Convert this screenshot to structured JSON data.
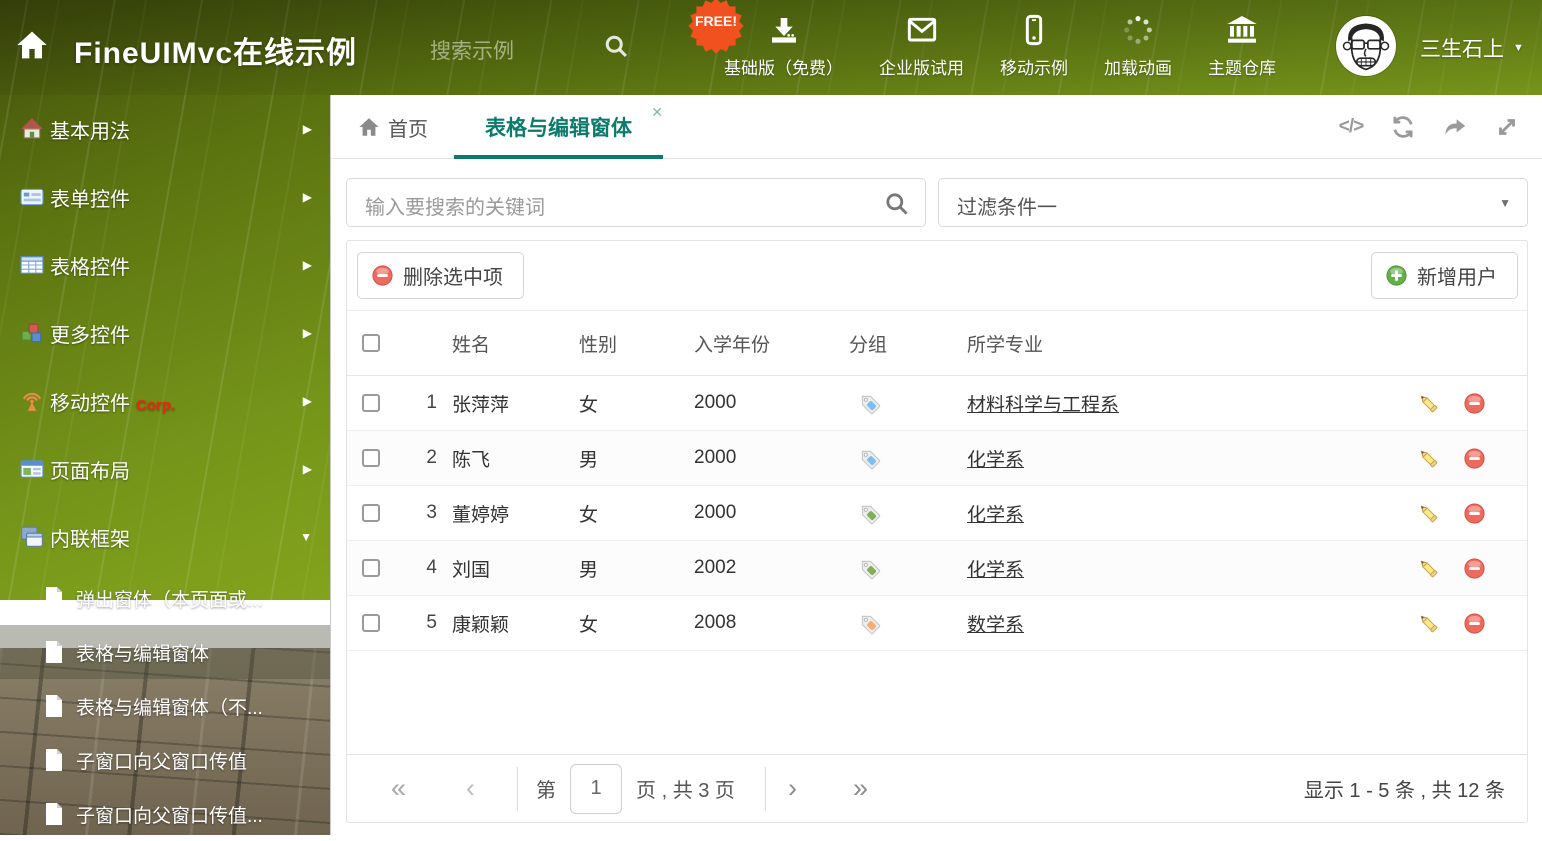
{
  "header": {
    "title": "FineUIMvc在线示例",
    "search_placeholder": "搜索示例",
    "free_badge": "FREE!",
    "nav": [
      {
        "label": "基础版（免费）",
        "icon": "download-icon"
      },
      {
        "label": "企业版试用",
        "icon": "envelope-icon"
      },
      {
        "label": "移动示例",
        "icon": "phone-icon"
      },
      {
        "label": "加载动画",
        "icon": "spinner-icon"
      },
      {
        "label": "主题仓库",
        "icon": "bank-icon"
      }
    ],
    "user_name": "三生石上"
  },
  "sidebar": {
    "items": [
      {
        "label": "基本用法",
        "icon": "home-icon"
      },
      {
        "label": "表单控件",
        "icon": "form-icon"
      },
      {
        "label": "表格控件",
        "icon": "table-icon"
      },
      {
        "label": "更多控件",
        "icon": "cubes-icon"
      },
      {
        "label": "移动控件",
        "badge": "Corp.",
        "icon": "antenna-icon"
      },
      {
        "label": "页面布局",
        "icon": "layout-icon"
      },
      {
        "label": "内联框架",
        "icon": "frames-icon"
      }
    ],
    "subitems": [
      {
        "label": "弹出窗体（本页面或..."
      },
      {
        "label": "表格与编辑窗体",
        "selected": true
      },
      {
        "label": "表格与编辑窗体（不..."
      },
      {
        "label": "子窗口向父窗口传值"
      },
      {
        "label": "子窗口向父窗口传值..."
      }
    ]
  },
  "tabs": {
    "home_label": "首页",
    "active_label": "表格与编辑窗体",
    "close_glyph": "✕"
  },
  "filter": {
    "search_placeholder": "输入要搜索的关键词",
    "dropdown_value": "过滤条件一"
  },
  "toolbar": {
    "delete_label": "删除选中项",
    "add_label": "新增用户"
  },
  "table": {
    "columns": {
      "name": "姓名",
      "gender": "性别",
      "year": "入学年份",
      "group": "分组",
      "major": "所学专业"
    },
    "rows": [
      {
        "num": "1",
        "name": "张萍萍",
        "gender": "女",
        "year": "2000",
        "tag_color": "blue",
        "major": "材料科学与工程系"
      },
      {
        "num": "2",
        "name": "陈飞",
        "gender": "男",
        "year": "2000",
        "tag_color": "blue",
        "major": "化学系"
      },
      {
        "num": "3",
        "name": "董婷婷",
        "gender": "女",
        "year": "2000",
        "tag_color": "green",
        "major": "化学系"
      },
      {
        "num": "4",
        "name": "刘国",
        "gender": "男",
        "year": "2002",
        "tag_color": "green",
        "major": "化学系"
      },
      {
        "num": "5",
        "name": "康颖颖",
        "gender": "女",
        "year": "2008",
        "tag_color": "orange",
        "major": "数学系"
      }
    ]
  },
  "pagination": {
    "first_glyph": "«",
    "prev_glyph": "‹",
    "page_prefix": "第",
    "page_value": "1",
    "page_suffix": "页 , 共 3 页",
    "next_glyph": "›",
    "last_glyph": "»",
    "summary": "显示 1 - 5 条 , 共 12 条"
  },
  "colors": {
    "accent": "#0c7a6d",
    "tag_blue": "#7cbdf2",
    "tag_green": "#82ae55",
    "tag_orange": "#f6ad70",
    "danger": "#ee6a5f",
    "success": "#66b04b"
  }
}
